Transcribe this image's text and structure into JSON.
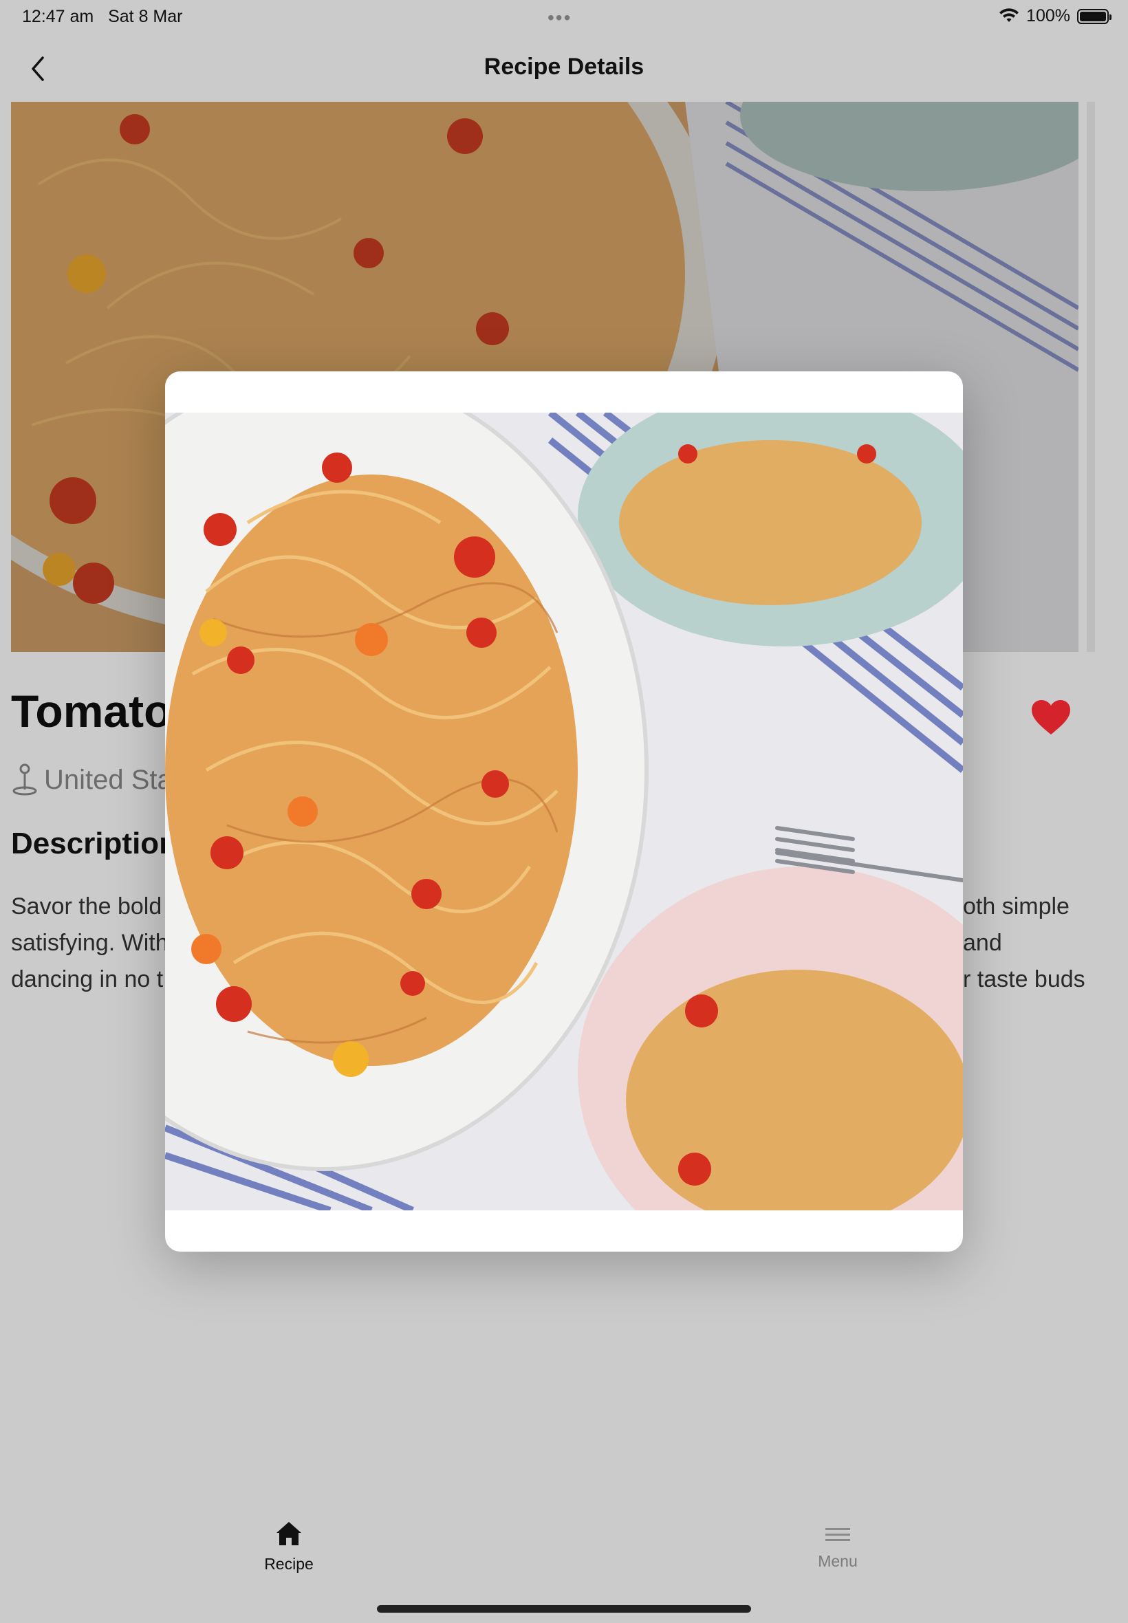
{
  "status_bar": {
    "time": "12:47 am",
    "date": "Sat 8 Mar",
    "battery": "100%"
  },
  "nav": {
    "title": "Recipe Details",
    "back_icon": "chevron-left-icon"
  },
  "recipe": {
    "title": "Tomato",
    "location": "United Sta",
    "description_heading": "Description",
    "description_lines": [
      "Savor the bold",
      "satisfying. With",
      "dancing in no t"
    ],
    "description_right_lines": [
      "oth simple and",
      "r taste buds",
      ""
    ],
    "favorite_color": "#d4232a"
  },
  "tabs": [
    {
      "label": "Recipe",
      "icon": "home-icon",
      "selected": true
    },
    {
      "label": "Menu",
      "icon": "menu-icon",
      "selected": false
    }
  ],
  "colors": {
    "background": "#cbcbcb",
    "modal": "#ffffff",
    "accent": "#d4232a"
  }
}
